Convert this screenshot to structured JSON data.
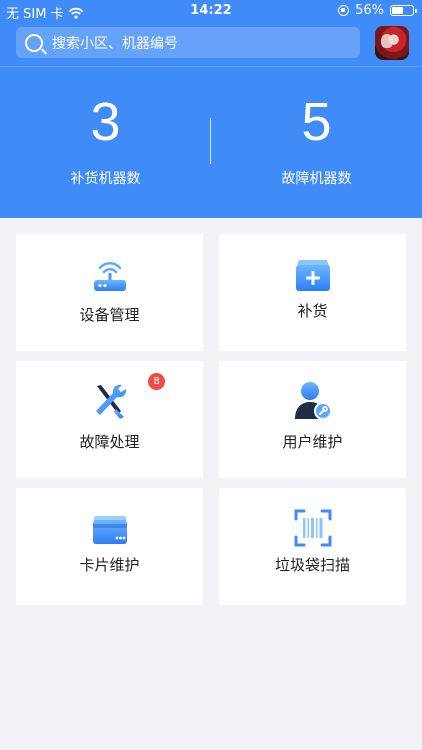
{
  "status_bar": {
    "carrier": "无 SIM 卡",
    "time": "14:22",
    "battery_percent": "56%",
    "battery_level": 0.56
  },
  "search": {
    "placeholder": "搜索小区、机器编号"
  },
  "stats": {
    "restock_count": "3",
    "restock_label": "补货机器数",
    "fault_count": "5",
    "fault_label": "故障机器数"
  },
  "menu": {
    "items": [
      {
        "label": "设备管理",
        "icon": "router-icon"
      },
      {
        "label": "补货",
        "icon": "restock-box-icon"
      },
      {
        "label": "故障处理",
        "icon": "tools-icon",
        "badge": "8"
      },
      {
        "label": "用户维护",
        "icon": "user-settings-icon"
      },
      {
        "label": "卡片维护",
        "icon": "card-icon"
      },
      {
        "label": "垃圾袋扫描",
        "icon": "barcode-scan-icon"
      }
    ]
  },
  "colors": {
    "primary": "#3f8bf8",
    "background": "#f2f2f7",
    "badge": "#ef4b47"
  }
}
